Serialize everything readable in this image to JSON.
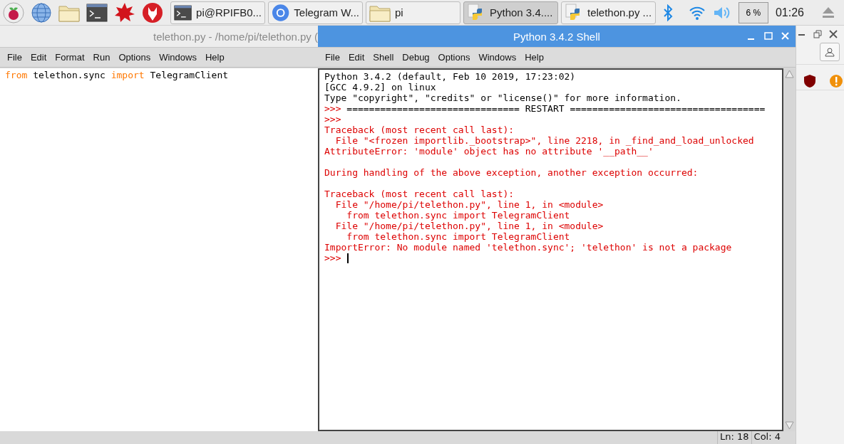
{
  "taskbar": {
    "launchers": [
      {
        "kind": "raspberry"
      },
      {
        "kind": "globe"
      },
      {
        "kind": "folder"
      },
      {
        "kind": "terminal"
      },
      {
        "kind": "star"
      },
      {
        "kind": "wolf"
      }
    ],
    "tasks": [
      {
        "label": "pi@RPIFB0...",
        "kind": "terminal",
        "selected": false
      },
      {
        "label": "Telegram W...",
        "kind": "browser",
        "selected": false
      },
      {
        "label": "pi",
        "kind": "folder",
        "selected": false
      },
      {
        "label": "Python 3.4....",
        "kind": "python",
        "selected": true
      },
      {
        "label": "telethon.py ...",
        "kind": "python",
        "selected": false
      }
    ],
    "tray": {
      "cpu": "6 %",
      "clock": "01:26"
    }
  },
  "editor_window": {
    "title": "telethon.py - /home/pi/telethon.py (",
    "active": false,
    "menu": [
      "File",
      "Edit",
      "Format",
      "Run",
      "Options",
      "Windows",
      "Help"
    ],
    "code_lines": [
      {
        "tokens": [
          {
            "kind": "keyword",
            "text": "from"
          },
          {
            "kind": "plain",
            "text": " telethon.sync "
          },
          {
            "kind": "keyword",
            "text": "import"
          },
          {
            "kind": "plain",
            "text": " TelegramClient"
          }
        ]
      }
    ]
  },
  "shell_window": {
    "title": "Python 3.4.2 Shell",
    "active": true,
    "menu": [
      "File",
      "Edit",
      "Shell",
      "Debug",
      "Options",
      "Windows",
      "Help"
    ],
    "lines": [
      {
        "kind": "output",
        "text": "Python 3.4.2 (default, Feb 10 2019, 17:23:02)"
      },
      {
        "kind": "output",
        "text": "[GCC 4.9.2] on linux"
      },
      {
        "kind": "output",
        "text": "Type \"copyright\", \"credits\" or \"license()\" for more information."
      },
      {
        "kind": "prompt",
        "prompt": ">>>",
        "text": "=============================== RESTART ===================================",
        "cursor": false
      },
      {
        "kind": "prompt",
        "prompt": ">>>",
        "cursor": false
      },
      {
        "kind": "error",
        "text": "Traceback (most recent call last):"
      },
      {
        "kind": "error",
        "text": "  File \"<frozen importlib._bootstrap>\", line 2218, in _find_and_load_unlocked"
      },
      {
        "kind": "error",
        "text": "AttributeError: 'module' object has no attribute '__path__'"
      },
      {
        "kind": "blank"
      },
      {
        "kind": "error",
        "text": "During handling of the above exception, another exception occurred:"
      },
      {
        "kind": "blank"
      },
      {
        "kind": "error",
        "text": "Traceback (most recent call last):"
      },
      {
        "kind": "error",
        "text": "  File \"/home/pi/telethon.py\", line 1, in <module>"
      },
      {
        "kind": "error",
        "text": "    from telethon.sync import TelegramClient"
      },
      {
        "kind": "error",
        "text": "  File \"/home/pi/telethon.py\", line 1, in <module>"
      },
      {
        "kind": "error",
        "text": "    from telethon.sync import TelegramClient"
      },
      {
        "kind": "error",
        "text": "ImportError: No module named 'telethon.sync'; 'telethon' is not a package"
      },
      {
        "kind": "prompt",
        "prompt": ">>>",
        "cursor": true
      }
    ],
    "status_bar": [
      "Ln: 18",
      "Col: 4"
    ]
  }
}
